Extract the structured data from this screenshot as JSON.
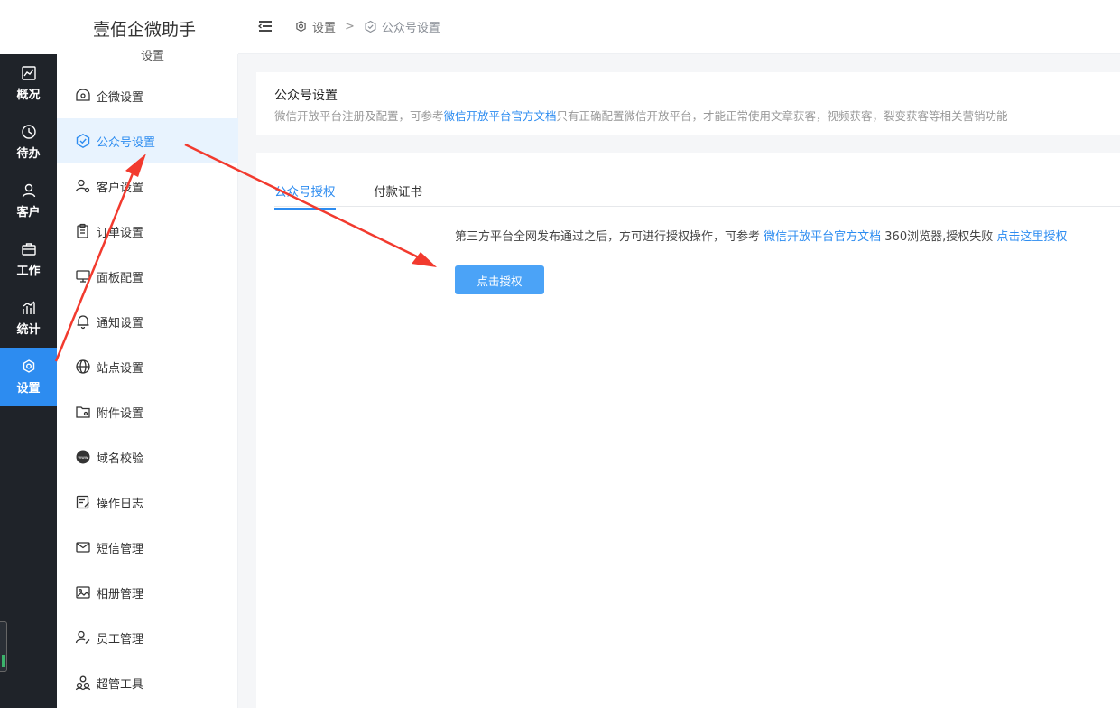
{
  "brand": {
    "title": "壹佰企微助手",
    "section": "设置"
  },
  "rail": [
    {
      "label": "概况",
      "icon": "chart-line-icon",
      "active": false
    },
    {
      "label": "待办",
      "icon": "clock-icon",
      "active": false
    },
    {
      "label": "客户",
      "icon": "user-icon",
      "active": false
    },
    {
      "label": "工作",
      "icon": "briefcase-icon",
      "active": false
    },
    {
      "label": "统计",
      "icon": "bar-chart-icon",
      "active": false
    },
    {
      "label": "设置",
      "icon": "gear-icon",
      "active": true
    }
  ],
  "submenu": [
    {
      "label": "企微设置",
      "icon": "wecom-icon",
      "active": false
    },
    {
      "label": "公众号设置",
      "icon": "badge-check-icon",
      "active": true
    },
    {
      "label": "客户设置",
      "icon": "user-gear-icon",
      "active": false
    },
    {
      "label": "订单设置",
      "icon": "clipboard-icon",
      "active": false
    },
    {
      "label": "面板配置",
      "icon": "monitor-icon",
      "active": false
    },
    {
      "label": "通知设置",
      "icon": "bell-icon",
      "active": false
    },
    {
      "label": "站点设置",
      "icon": "globe-icon",
      "active": false
    },
    {
      "label": "附件设置",
      "icon": "folder-icon",
      "active": false
    },
    {
      "label": "域名校验",
      "icon": "www-icon",
      "active": false
    },
    {
      "label": "操作日志",
      "icon": "log-icon",
      "active": false
    },
    {
      "label": "短信管理",
      "icon": "mail-icon",
      "active": false
    },
    {
      "label": "相册管理",
      "icon": "image-icon",
      "active": false
    },
    {
      "label": "员工管理",
      "icon": "user-edit-icon",
      "active": false
    },
    {
      "label": "超管工具",
      "icon": "users-icon",
      "active": false
    }
  ],
  "breadcrumb": {
    "items": [
      {
        "label": "设置",
        "icon": "gear-icon"
      },
      {
        "label": "公众号设置",
        "icon": "badge-check-icon"
      }
    ],
    "separator": ">"
  },
  "info": {
    "title": "公众号设置",
    "desc_before": "微信开放平台注册及配置，可参考",
    "desc_link": "微信开放平台官方文档",
    "desc_after": "只有正确配置微信开放平台，才能正常使用文章获客，视频获客，裂变获客等相关营销功能"
  },
  "tabs": [
    {
      "label": "公众号授权",
      "active": true
    },
    {
      "label": "付款证书",
      "active": false
    }
  ],
  "auth": {
    "text_before": "第三方平台全网发布通过之后，方可进行授权操作，可参考 ",
    "doc_link": "微信开放平台官方文档",
    "text_middle": " 360浏览器,授权失败 ",
    "retry_link": "点击这里授权",
    "button_label": "点击授权"
  },
  "colors": {
    "accent": "#2d8cf0",
    "rail": "#1f2329",
    "button": "#4ba3f7",
    "annotation": "#f23a2e"
  }
}
